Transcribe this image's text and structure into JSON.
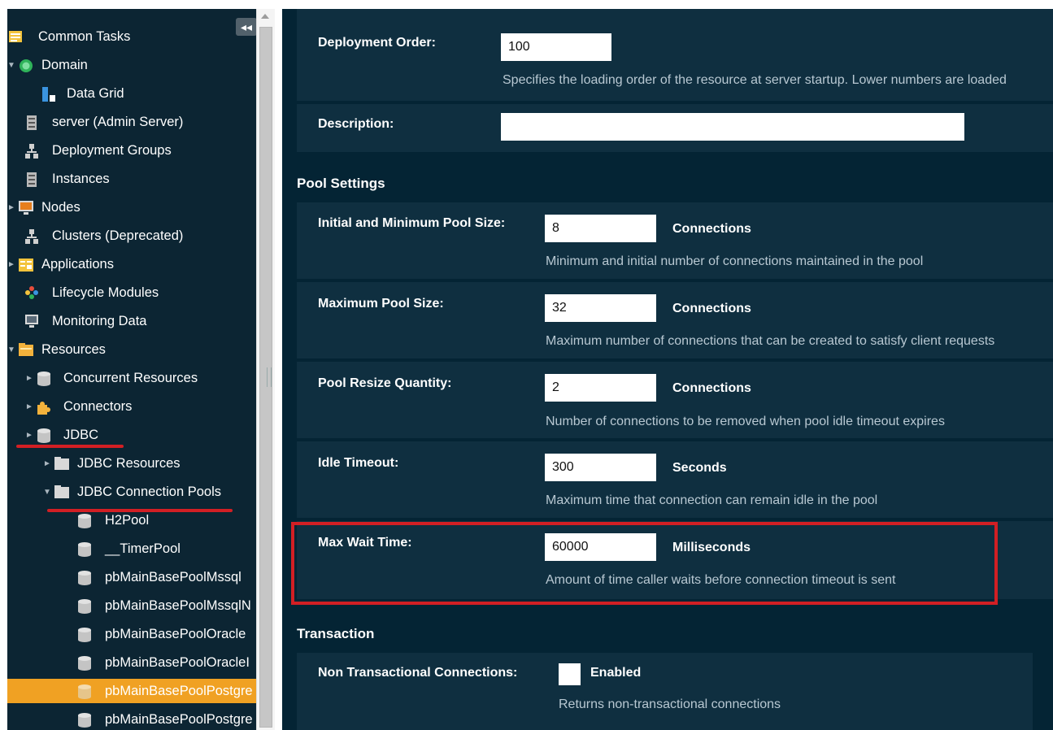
{
  "sidebar": {
    "collapse_icon": "collapse-left-icon",
    "items": [
      {
        "label": "Common Tasks",
        "icon": "tasks-icon"
      },
      {
        "label": "Domain",
        "icon": "domain-globe-icon"
      },
      {
        "label": "Data Grid",
        "icon": "data-grid-icon"
      },
      {
        "label": "server (Admin Server)",
        "icon": "server-icon"
      },
      {
        "label": "Deployment Groups",
        "icon": "cluster-icon"
      },
      {
        "label": "Instances",
        "icon": "server-icon"
      },
      {
        "label": "Nodes",
        "icon": "monitor-icon"
      },
      {
        "label": "Clusters (Deprecated)",
        "icon": "cluster-icon"
      },
      {
        "label": "Applications",
        "icon": "applications-icon"
      },
      {
        "label": "Lifecycle Modules",
        "icon": "lifecycle-icon"
      },
      {
        "label": "Monitoring Data",
        "icon": "monitor-icon"
      },
      {
        "label": "Resources",
        "icon": "folder-icon"
      },
      {
        "label": "Concurrent Resources",
        "icon": "database-icon"
      },
      {
        "label": "Connectors",
        "icon": "puzzle-icon"
      },
      {
        "label": "JDBC",
        "icon": "database-icon"
      },
      {
        "label": "JDBC Resources",
        "icon": "folder-icon"
      },
      {
        "label": "JDBC Connection Pools",
        "icon": "folder-icon"
      },
      {
        "label": "H2Pool",
        "icon": "database-icon"
      },
      {
        "label": "__TimerPool",
        "icon": "database-icon"
      },
      {
        "label": "pbMainBasePoolMssql",
        "icon": "database-icon"
      },
      {
        "label": "pbMainBasePoolMssqlN",
        "icon": "database-icon"
      },
      {
        "label": "pbMainBasePoolOracle",
        "icon": "database-icon"
      },
      {
        "label": "pbMainBasePoolOracleI",
        "icon": "database-icon"
      },
      {
        "label": "pbMainBasePoolPostgre",
        "icon": "database-icon"
      },
      {
        "label": "pbMainBasePoolPostgre",
        "icon": "database-icon"
      }
    ]
  },
  "general": {
    "deployment_order_label": "Deployment Order:",
    "deployment_order_value": "100",
    "deployment_order_help": "Specifies the loading order of the resource at server startup. Lower numbers are loaded",
    "description_label": "Description:",
    "description_value": ""
  },
  "pool_settings": {
    "title": "Pool Settings",
    "initial_label": "Initial and Minimum Pool Size:",
    "initial_value": "8",
    "initial_unit": "Connections",
    "initial_help": "Minimum and initial number of connections maintained in the pool",
    "max_label": "Maximum Pool Size:",
    "max_value": "32",
    "max_unit": "Connections",
    "max_help": "Maximum number of connections that can be created to satisfy client requests",
    "resize_label": "Pool Resize Quantity:",
    "resize_value": "2",
    "resize_unit": "Connections",
    "resize_help": "Number of connections to be removed when pool idle timeout expires",
    "idle_label": "Idle Timeout:",
    "idle_value": "300",
    "idle_unit": "Seconds",
    "idle_help": "Maximum time that connection can remain idle in the pool",
    "wait_label": "Max Wait Time:",
    "wait_value": "60000",
    "wait_unit": "Milliseconds",
    "wait_help": "Amount of time caller waits before connection timeout is sent"
  },
  "transaction": {
    "title": "Transaction",
    "non_tx_label": "Non Transactional Connections:",
    "non_tx_option": "Enabled",
    "non_tx_checked": false,
    "non_tx_help": "Returns non-transactional connections"
  },
  "colors": {
    "sidebar_bg": "#0c2533",
    "main_bg": "#042434",
    "panel_bg": "#0f2f40",
    "selected_bg": "#f0a123",
    "annotation_red": "#d21f24"
  }
}
